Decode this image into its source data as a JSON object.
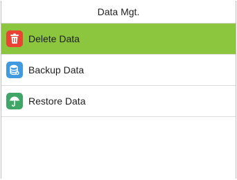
{
  "header": {
    "title": "Data Mgt."
  },
  "menu": {
    "items": [
      {
        "label": "Delete Data",
        "icon": "trash-icon",
        "icon_color": "#EA4335",
        "selected": true,
        "selected_color": "#8CC63F"
      },
      {
        "label": "Backup Data",
        "icon": "database-icon",
        "icon_color": "#3F9AE0",
        "selected": false
      },
      {
        "label": "Restore Data",
        "icon": "umbrella-icon",
        "icon_color": "#3FA668",
        "selected": false
      }
    ]
  }
}
